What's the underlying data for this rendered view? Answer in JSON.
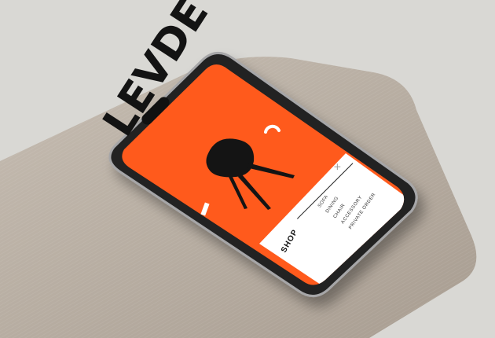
{
  "app": {
    "brand": "LEVDE"
  },
  "menu": {
    "items": [
      {
        "label": "SOFA"
      },
      {
        "label": "DINING"
      },
      {
        "label": "CHAIR"
      },
      {
        "label": "ACCESSORY"
      },
      {
        "label": "PRIVATE ORDER"
      }
    ],
    "section_title": "SHOP",
    "close_symbol": "×"
  },
  "colors": {
    "accent": "#ff5a1c",
    "panel": "#ffffff",
    "cushion": "#b8aea3",
    "background": "#d9d8d4"
  },
  "icons": {
    "chair_illustration": "chair-icon",
    "loader": "loading-arc-icon",
    "close": "close-icon"
  }
}
